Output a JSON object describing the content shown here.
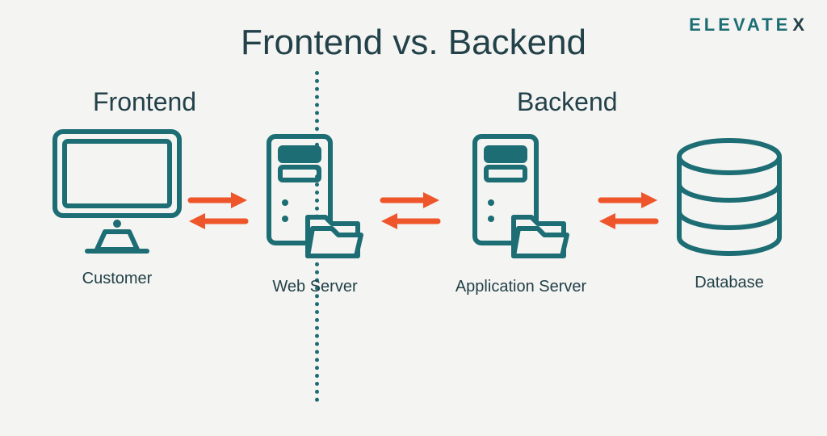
{
  "brand": {
    "name": "ELEVATE",
    "suffix": "X"
  },
  "title": "Frontend vs. Backend",
  "sections": {
    "frontend": "Frontend",
    "backend": "Backend"
  },
  "nodes": {
    "customer": "Customer",
    "webserver": "Web Server",
    "appserver": "Application Server",
    "database": "Database"
  },
  "colors": {
    "teal": "#1c6d74",
    "dark": "#234149",
    "arrow": "#ef552b"
  }
}
